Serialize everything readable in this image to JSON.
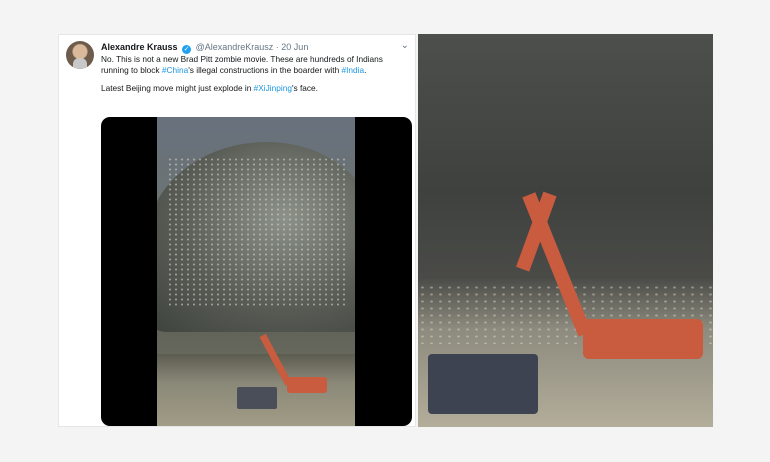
{
  "tweet": {
    "author_name": "Alexandre Krauss",
    "handle": "@AlexandreKrausz",
    "separator": "·",
    "date": "20 Jun",
    "text_part1": "No. This is not a new Brad Pitt zombie movie. These are hundreds of Indians running to block ",
    "hashtag_china": "#China",
    "text_part2": "'s illegal constructions in the boarder with ",
    "hashtag_india": "#India",
    "text_part3": ".",
    "text2_part1": "Latest Beijing move might just explode in ",
    "hashtag_xijinping": "#XiJinping",
    "text2_part2": "'s face.",
    "menu_icon": "chevron-down-icon",
    "verified_icon": "verified-badge-icon"
  },
  "colors": {
    "link": "#1b95e0",
    "verified": "#1da1f2",
    "excavator": "#c95b3f"
  }
}
